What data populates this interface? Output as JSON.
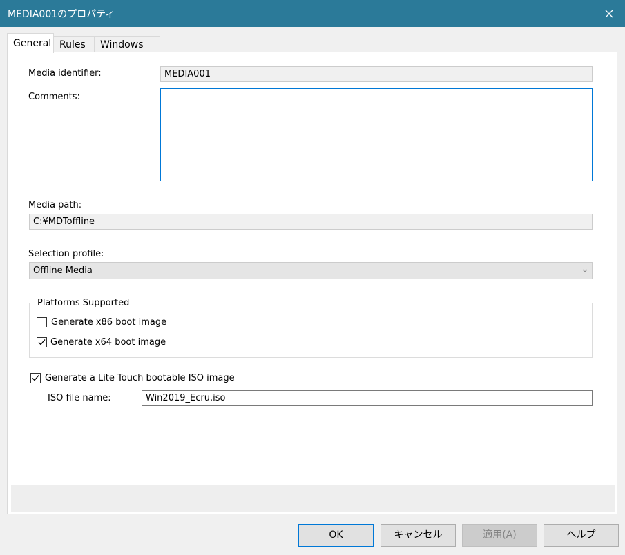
{
  "window": {
    "title": "MEDIA001のプロパティ"
  },
  "tabs": [
    {
      "label": "General"
    },
    {
      "label": "Rules"
    },
    {
      "label": "Windows PE"
    }
  ],
  "general": {
    "media_identifier": {
      "label": "Media identifier:",
      "value": "MEDIA001"
    },
    "comments": {
      "label": "Comments:",
      "value": ""
    },
    "media_path": {
      "label": "Media path:",
      "value": "C:¥MDToffline"
    },
    "selection_profile": {
      "label": "Selection profile:",
      "value": "Offline Media"
    },
    "platforms": {
      "title": "Platforms Supported",
      "x86": {
        "label": "Generate x86 boot image",
        "checked": false
      },
      "x64": {
        "label": "Generate x64 boot image",
        "checked": true
      }
    },
    "iso": {
      "label": "Generate a Lite Touch bootable ISO image",
      "checked": true,
      "file_label": "ISO file name:",
      "file_value": "Win2019_Ecru.iso"
    }
  },
  "buttons": {
    "ok": "OK",
    "cancel": "キャンセル",
    "apply": "適用(A)",
    "help": "ヘルプ"
  }
}
